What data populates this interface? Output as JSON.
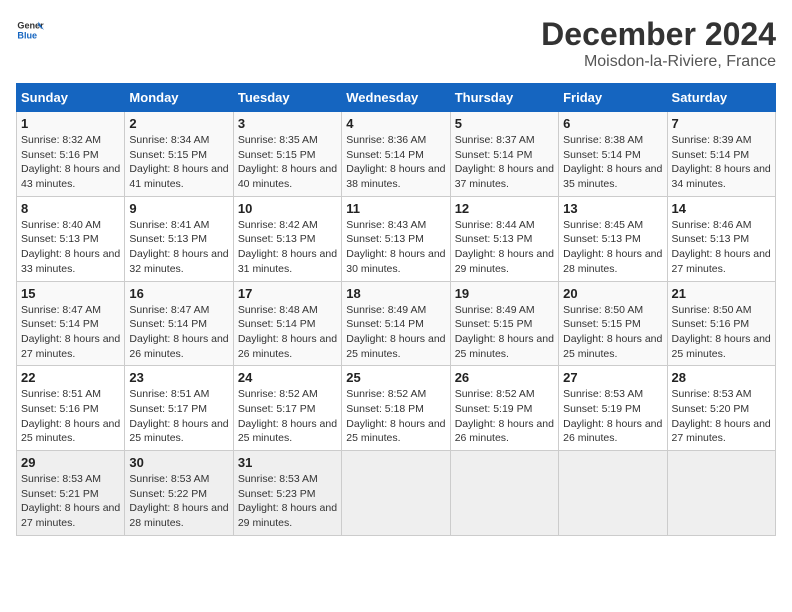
{
  "header": {
    "logo_general": "General",
    "logo_blue": "Blue",
    "title": "December 2024",
    "subtitle": "Moisdon-la-Riviere, France"
  },
  "calendar": {
    "weekdays": [
      "Sunday",
      "Monday",
      "Tuesday",
      "Wednesday",
      "Thursday",
      "Friday",
      "Saturday"
    ],
    "weeks": [
      [
        {
          "day": "1",
          "sunrise": "8:32 AM",
          "sunset": "5:16 PM",
          "daylight": "8 hours and 43 minutes."
        },
        {
          "day": "2",
          "sunrise": "8:34 AM",
          "sunset": "5:15 PM",
          "daylight": "8 hours and 41 minutes."
        },
        {
          "day": "3",
          "sunrise": "8:35 AM",
          "sunset": "5:15 PM",
          "daylight": "8 hours and 40 minutes."
        },
        {
          "day": "4",
          "sunrise": "8:36 AM",
          "sunset": "5:14 PM",
          "daylight": "8 hours and 38 minutes."
        },
        {
          "day": "5",
          "sunrise": "8:37 AM",
          "sunset": "5:14 PM",
          "daylight": "8 hours and 37 minutes."
        },
        {
          "day": "6",
          "sunrise": "8:38 AM",
          "sunset": "5:14 PM",
          "daylight": "8 hours and 35 minutes."
        },
        {
          "day": "7",
          "sunrise": "8:39 AM",
          "sunset": "5:14 PM",
          "daylight": "8 hours and 34 minutes."
        }
      ],
      [
        {
          "day": "8",
          "sunrise": "8:40 AM",
          "sunset": "5:13 PM",
          "daylight": "8 hours and 33 minutes."
        },
        {
          "day": "9",
          "sunrise": "8:41 AM",
          "sunset": "5:13 PM",
          "daylight": "8 hours and 32 minutes."
        },
        {
          "day": "10",
          "sunrise": "8:42 AM",
          "sunset": "5:13 PM",
          "daylight": "8 hours and 31 minutes."
        },
        {
          "day": "11",
          "sunrise": "8:43 AM",
          "sunset": "5:13 PM",
          "daylight": "8 hours and 30 minutes."
        },
        {
          "day": "12",
          "sunrise": "8:44 AM",
          "sunset": "5:13 PM",
          "daylight": "8 hours and 29 minutes."
        },
        {
          "day": "13",
          "sunrise": "8:45 AM",
          "sunset": "5:13 PM",
          "daylight": "8 hours and 28 minutes."
        },
        {
          "day": "14",
          "sunrise": "8:46 AM",
          "sunset": "5:13 PM",
          "daylight": "8 hours and 27 minutes."
        }
      ],
      [
        {
          "day": "15",
          "sunrise": "8:47 AM",
          "sunset": "5:14 PM",
          "daylight": "8 hours and 27 minutes."
        },
        {
          "day": "16",
          "sunrise": "8:47 AM",
          "sunset": "5:14 PM",
          "daylight": "8 hours and 26 minutes."
        },
        {
          "day": "17",
          "sunrise": "8:48 AM",
          "sunset": "5:14 PM",
          "daylight": "8 hours and 26 minutes."
        },
        {
          "day": "18",
          "sunrise": "8:49 AM",
          "sunset": "5:14 PM",
          "daylight": "8 hours and 25 minutes."
        },
        {
          "day": "19",
          "sunrise": "8:49 AM",
          "sunset": "5:15 PM",
          "daylight": "8 hours and 25 minutes."
        },
        {
          "day": "20",
          "sunrise": "8:50 AM",
          "sunset": "5:15 PM",
          "daylight": "8 hours and 25 minutes."
        },
        {
          "day": "21",
          "sunrise": "8:50 AM",
          "sunset": "5:16 PM",
          "daylight": "8 hours and 25 minutes."
        }
      ],
      [
        {
          "day": "22",
          "sunrise": "8:51 AM",
          "sunset": "5:16 PM",
          "daylight": "8 hours and 25 minutes."
        },
        {
          "day": "23",
          "sunrise": "8:51 AM",
          "sunset": "5:17 PM",
          "daylight": "8 hours and 25 minutes."
        },
        {
          "day": "24",
          "sunrise": "8:52 AM",
          "sunset": "5:17 PM",
          "daylight": "8 hours and 25 minutes."
        },
        {
          "day": "25",
          "sunrise": "8:52 AM",
          "sunset": "5:18 PM",
          "daylight": "8 hours and 25 minutes."
        },
        {
          "day": "26",
          "sunrise": "8:52 AM",
          "sunset": "5:19 PM",
          "daylight": "8 hours and 26 minutes."
        },
        {
          "day": "27",
          "sunrise": "8:53 AM",
          "sunset": "5:19 PM",
          "daylight": "8 hours and 26 minutes."
        },
        {
          "day": "28",
          "sunrise": "8:53 AM",
          "sunset": "5:20 PM",
          "daylight": "8 hours and 27 minutes."
        }
      ],
      [
        {
          "day": "29",
          "sunrise": "8:53 AM",
          "sunset": "5:21 PM",
          "daylight": "8 hours and 27 minutes."
        },
        {
          "day": "30",
          "sunrise": "8:53 AM",
          "sunset": "5:22 PM",
          "daylight": "8 hours and 28 minutes."
        },
        {
          "day": "31",
          "sunrise": "8:53 AM",
          "sunset": "5:23 PM",
          "daylight": "8 hours and 29 minutes."
        },
        null,
        null,
        null,
        null
      ]
    ]
  }
}
